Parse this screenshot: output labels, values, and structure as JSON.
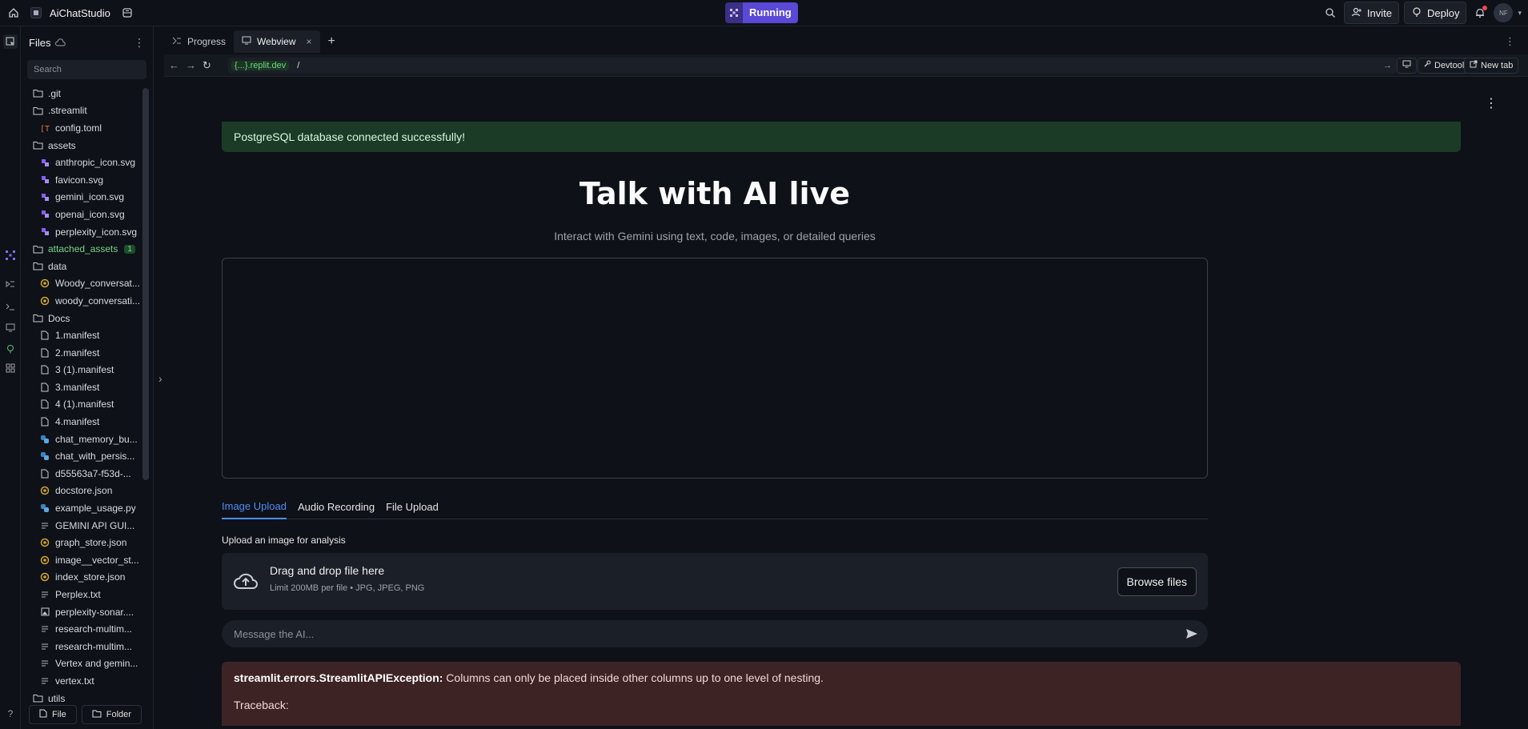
{
  "topbar": {
    "app_name": "AiChatStudio",
    "run_status": "Running",
    "invite_label": "Invite",
    "deploy_label": "Deploy",
    "avatar_initials": "NF"
  },
  "files": {
    "title": "Files",
    "search_placeholder": "Search",
    "tree": [
      {
        "name": ".git",
        "type": "folder",
        "level": 0
      },
      {
        "name": ".streamlit",
        "type": "folder",
        "level": 0
      },
      {
        "name": "config.toml",
        "type": "toml",
        "level": 1
      },
      {
        "name": "assets",
        "type": "folder",
        "level": 0
      },
      {
        "name": "anthropic_icon.svg",
        "type": "svg",
        "level": 1
      },
      {
        "name": "favicon.svg",
        "type": "svg",
        "level": 1
      },
      {
        "name": "gemini_icon.svg",
        "type": "svg",
        "level": 1
      },
      {
        "name": "openai_icon.svg",
        "type": "svg",
        "level": 1
      },
      {
        "name": "perplexity_icon.svg",
        "type": "svg",
        "level": 1
      },
      {
        "name": "attached_assets",
        "type": "folder",
        "level": 0,
        "badge": "1",
        "green": true
      },
      {
        "name": "data",
        "type": "folder",
        "level": 0
      },
      {
        "name": "Woody_conversat...",
        "type": "json",
        "level": 1
      },
      {
        "name": "woody_conversati...",
        "type": "json",
        "level": 1
      },
      {
        "name": "Docs",
        "type": "folder",
        "level": 0
      },
      {
        "name": "1.manifest",
        "type": "file",
        "level": 1
      },
      {
        "name": "2.manifest",
        "type": "file",
        "level": 1
      },
      {
        "name": "3 (1).manifest",
        "type": "file",
        "level": 1
      },
      {
        "name": "3.manifest",
        "type": "file",
        "level": 1
      },
      {
        "name": "4 (1).manifest",
        "type": "file",
        "level": 1
      },
      {
        "name": "4.manifest",
        "type": "file",
        "level": 1
      },
      {
        "name": "chat_memory_bu...",
        "type": "python",
        "level": 1
      },
      {
        "name": "chat_with_persis...",
        "type": "python",
        "level": 1
      },
      {
        "name": "d55563a7-f53d-...",
        "type": "file",
        "level": 1
      },
      {
        "name": "docstore.json",
        "type": "json",
        "level": 1
      },
      {
        "name": "example_usage.py",
        "type": "python",
        "level": 1
      },
      {
        "name": "GEMINI API GUI...",
        "type": "text",
        "level": 1
      },
      {
        "name": "graph_store.json",
        "type": "json",
        "level": 1
      },
      {
        "name": "image__vector_st...",
        "type": "json",
        "level": 1
      },
      {
        "name": "index_store.json",
        "type": "json",
        "level": 1
      },
      {
        "name": "Perplex.txt",
        "type": "text",
        "level": 1
      },
      {
        "name": "perplexity-sonar....",
        "type": "image",
        "level": 1
      },
      {
        "name": "research-multim...",
        "type": "text",
        "level": 1
      },
      {
        "name": "research-multim...",
        "type": "text",
        "level": 1
      },
      {
        "name": "Vertex and gemin...",
        "type": "text",
        "level": 1
      },
      {
        "name": "vertex.txt",
        "type": "text",
        "level": 1
      },
      {
        "name": "utils",
        "type": "folder",
        "level": 0
      }
    ],
    "new_file_label": "File",
    "new_folder_label": "Folder"
  },
  "tabs": [
    {
      "label": "Progress",
      "active": false
    },
    {
      "label": "Webview",
      "active": true
    }
  ],
  "urlbar": {
    "domain": "{...}.replit.dev",
    "path": "/",
    "devtools_label": "Devtools",
    "newtab_label": "New tab"
  },
  "webview": {
    "success_message": "PostgreSQL database connected successfully!",
    "title": "Talk with AI live",
    "subtitle": "Interact with Gemini using text, code, images, or detailed queries",
    "upload_tabs": [
      "Image Upload",
      "Audio Recording",
      "File Upload"
    ],
    "upload_label": "Upload an image for analysis",
    "dropzone_main": "Drag and drop file here",
    "dropzone_sub": "Limit 200MB per file • JPG, JPEG, PNG",
    "browse_label": "Browse files",
    "message_placeholder": "Message the AI...",
    "error_type": "streamlit.errors.StreamlitAPIException:",
    "error_message": " Columns can only be placed inside other columns up to one level of nesting.",
    "traceback_label": "Traceback:"
  },
  "colors": {
    "accent": "#5a48d6",
    "tab_active": "#4f8df5",
    "success_bg": "#1c3b26",
    "error_bg": "#3e2325"
  }
}
